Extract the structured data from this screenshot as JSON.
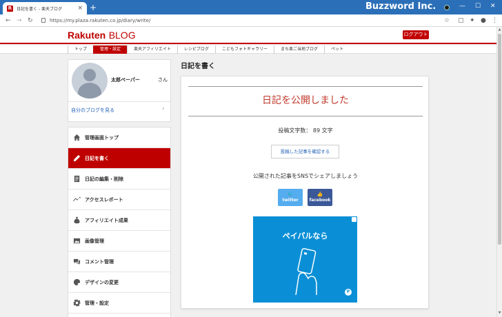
{
  "browser": {
    "tab_title": "日記を書く - 楽天ブログ",
    "tab_favicon": "R",
    "window_title": "Buzzword Inc.",
    "url": "https://my.plaza.rakuten.co.jp/diary/write/"
  },
  "header": {
    "logo_main": "Rakuten",
    "logo_sub": "BLOG",
    "logout_label": "ログアウト",
    "brand_color": "#bf0000"
  },
  "nav": {
    "items": [
      {
        "label": "トップ"
      },
      {
        "label": "管理・設定"
      },
      {
        "label": "楽天アフィリエイト"
      },
      {
        "label": "レシピブログ"
      },
      {
        "label": "こどもフォトギャラリー"
      },
      {
        "label": "まち楽ご当地ブログ"
      },
      {
        "label": "ペット"
      }
    ]
  },
  "user": {
    "name": "太郎ペーパー",
    "honorific": "さん",
    "blog_link": "自分のブログを見る"
  },
  "menu": {
    "items": [
      {
        "label": "管理画面トップ",
        "icon": "home-icon"
      },
      {
        "label": "日記を書く",
        "icon": "pencil-icon"
      },
      {
        "label": "日記の編集・削除",
        "icon": "document-icon"
      },
      {
        "label": "アクセスレポート",
        "icon": "chart-icon"
      },
      {
        "label": "アフィリエイト成果",
        "icon": "money-bag-icon"
      },
      {
        "label": "画像管理",
        "icon": "image-icon"
      },
      {
        "label": "コメント管理",
        "icon": "comment-icon"
      },
      {
        "label": "デザインの変更",
        "icon": "palette-icon"
      },
      {
        "label": "管理・設定",
        "icon": "gear-icon"
      }
    ]
  },
  "main": {
    "page_title": "日記を書く",
    "heading": "日記を公開しました",
    "char_count": "投稿文字数： 89 文字",
    "confirm_button": "投稿した記事を確認する",
    "share_text": "公開された記事をSNSでシェアしましょう",
    "share": {
      "twitter_label": "twitter",
      "facebook_label": "facebook"
    },
    "ad_text": "ペイパルなら"
  }
}
